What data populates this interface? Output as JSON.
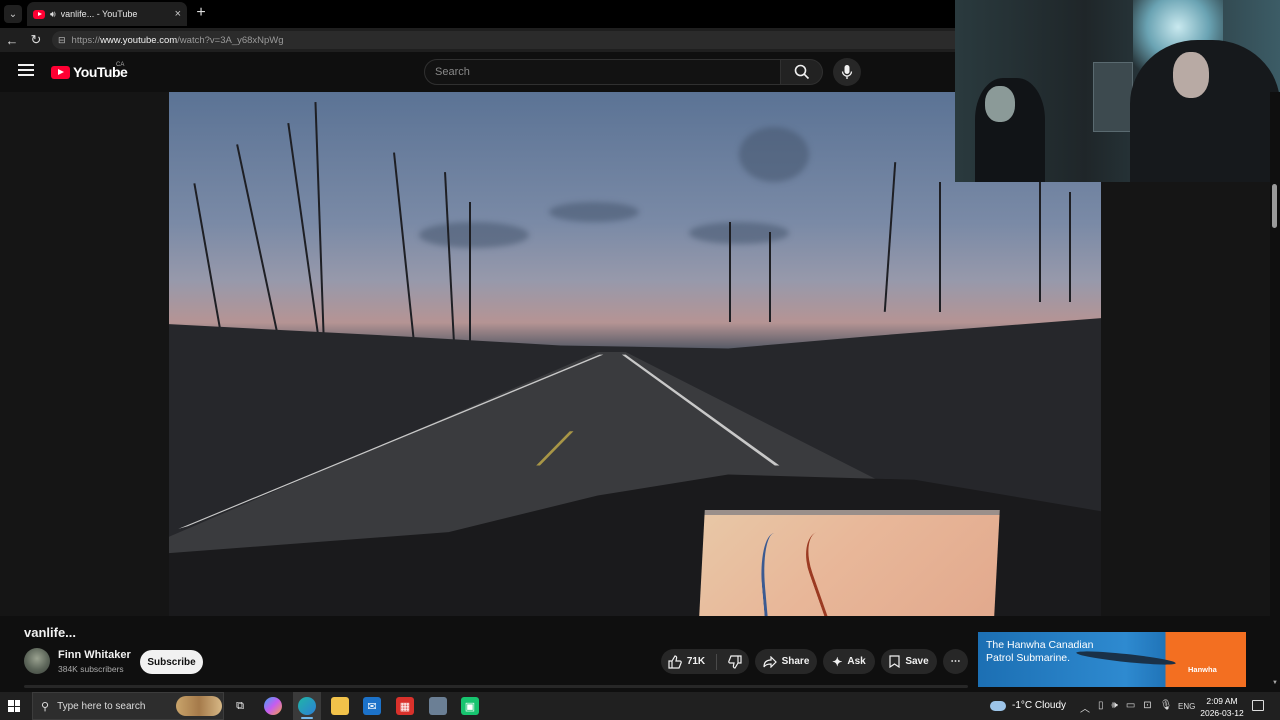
{
  "browser": {
    "tab_title": "vanlife... - YouTube",
    "tab_close": "×",
    "new_tab": "+",
    "url_protocol": "https://",
    "url_host": "www.youtube.com",
    "url_path": "/watch?v=3A_y68xNpWg"
  },
  "masthead": {
    "logo_text": "YouTube",
    "country_code": "CA",
    "search_placeholder": "Search"
  },
  "video": {
    "title": "vanlife...",
    "channel_name": "Finn Whitaker",
    "subscriber_count": "384K subscribers",
    "subscribe_label": "Subscribe",
    "like_count": "71K",
    "share_label": "Share",
    "ask_label": "Ask",
    "save_label": "Save",
    "more_label": "⋯"
  },
  "ad": {
    "text": "The Hanwha Canadian Patrol Submarine.",
    "brand": "Hanwha"
  },
  "taskbar": {
    "search_placeholder": "Type here to search",
    "weather": "-1°C  Cloudy",
    "language": "ENG",
    "time": "2:09 AM",
    "date": "2026-03-12"
  },
  "colors": {
    "youtube_red": "#ff0033",
    "background": "#0f0f0f",
    "pill": "#272727",
    "taskbar": "#202020"
  }
}
